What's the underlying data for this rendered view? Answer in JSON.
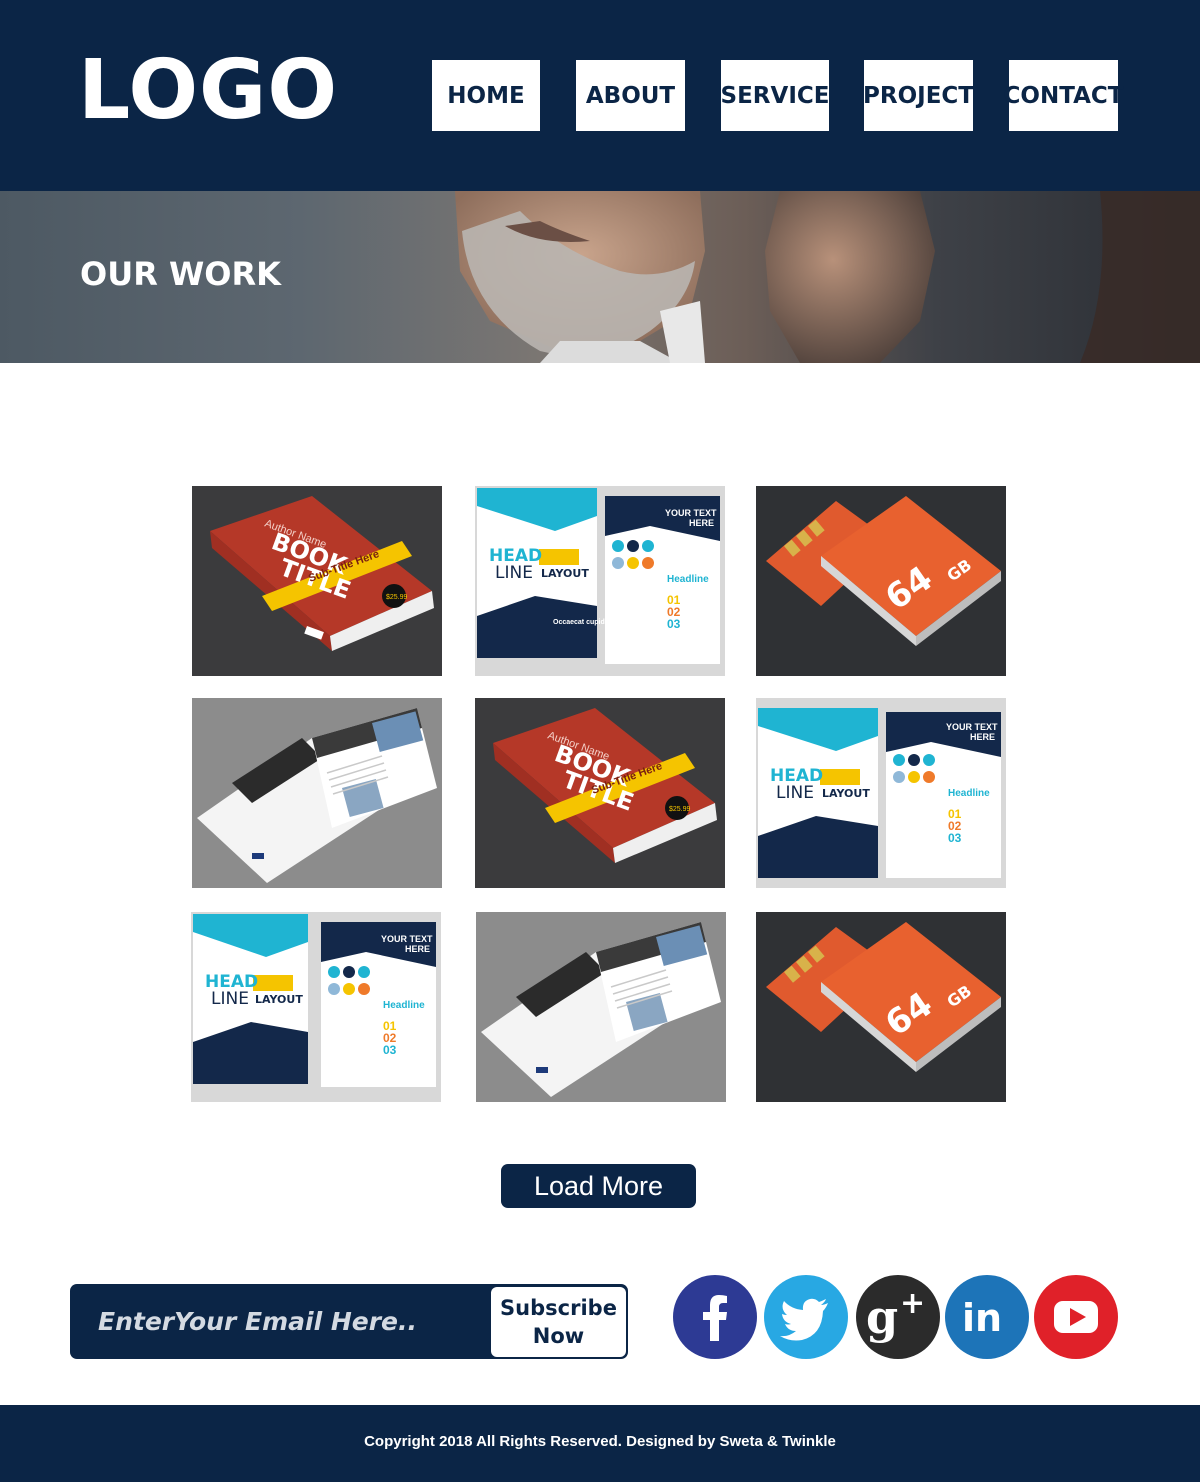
{
  "header": {
    "logo": "LOGO",
    "nav": [
      "HOME",
      "ABOUT",
      "SERVICE",
      "PROJECT",
      "CONTACT"
    ]
  },
  "hero": {
    "title": "OUR WORK"
  },
  "gallery": {
    "book": {
      "author": "Author Name",
      "title_line1": "BOOK",
      "title_line2": "TITLE",
      "subtitle": "Sub-Title Here",
      "price": "$25.99"
    },
    "flyer": {
      "head1": "HEAD",
      "head2": "LINE",
      "layout": "LAYOUT",
      "your_text1": "YOUR TEXT",
      "your_text2": "HERE",
      "headline": "Headline",
      "n1": "01",
      "n2": "02",
      "n3": "03",
      "occaecat": "Occaecat cupidatat"
    },
    "sd_card": {
      "capacity": "64",
      "unit": "GB"
    }
  },
  "load_more": "Load More",
  "subscribe": {
    "placeholder": "EnterYour Email Here..",
    "button_line1": "Subscribe",
    "button_line2": "Now"
  },
  "social": [
    {
      "name": "facebook-icon",
      "color": "#2d3a94"
    },
    {
      "name": "twitter-icon",
      "color": "#28a8e3"
    },
    {
      "name": "google-plus-icon",
      "color": "#2b2b2b"
    },
    {
      "name": "linkedin-icon",
      "color": "#1d74b8"
    },
    {
      "name": "youtube-icon",
      "color": "#e02129"
    }
  ],
  "footer": {
    "copyright": "Copyright 2018 All Rights Reserved. Designed by Sweta & Twinkle"
  },
  "colors": {
    "navy": "#0b2546",
    "book_red": "#b53828",
    "sd_orange": "#e05a2e",
    "flyer_cyan": "#1fb4d2",
    "flyer_yellow": "#f5c400"
  }
}
